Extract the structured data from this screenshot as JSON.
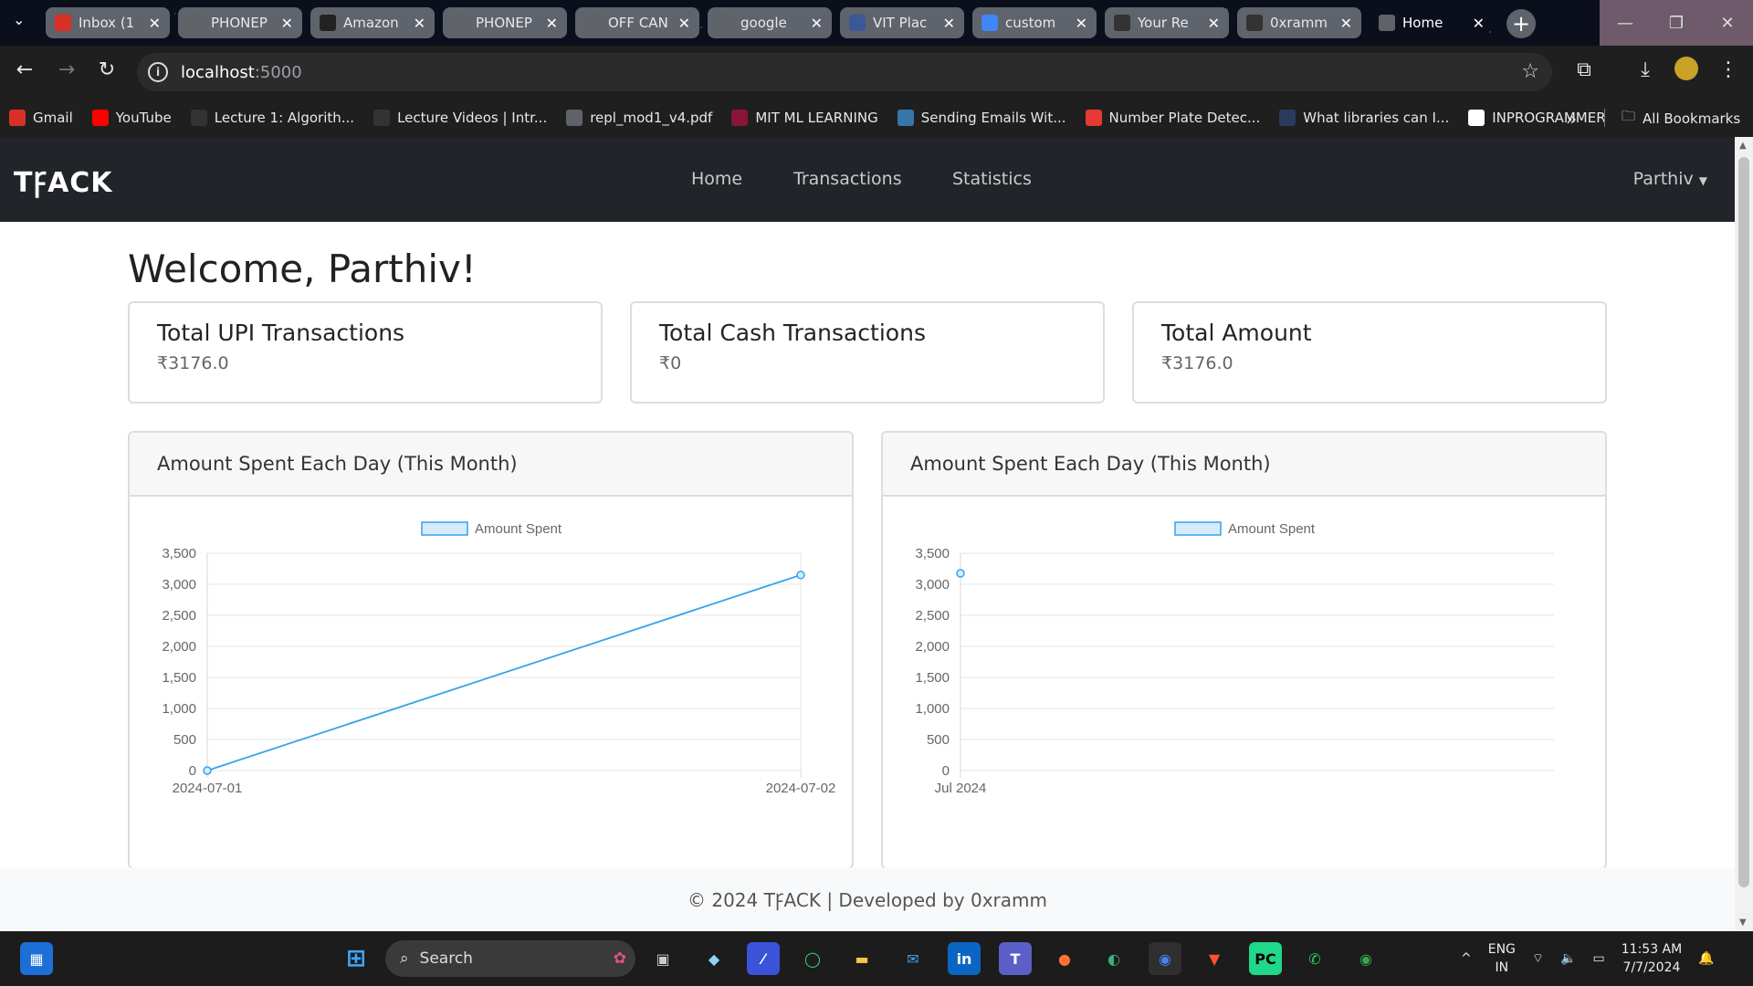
{
  "browser": {
    "tabs": [
      {
        "title": "Inbox (1",
        "icon": "gmail-icon",
        "color": "#d93025"
      },
      {
        "title": "PHONEP",
        "icon": "web-icon",
        "color": "#5f6368"
      },
      {
        "title": "Amazon",
        "icon": "amazon-icon",
        "color": "#222222"
      },
      {
        "title": "PHONEP",
        "icon": "web-icon",
        "color": "#5f6368"
      },
      {
        "title": "OFF CAN",
        "icon": "web-icon",
        "color": "#5f6368"
      },
      {
        "title": "google",
        "icon": "web-icon",
        "color": "#5f6368"
      },
      {
        "title": "VIT Plac",
        "icon": "vit-icon",
        "color": "#3b5998"
      },
      {
        "title": "custom",
        "icon": "google-icon",
        "color": "#4285f4"
      },
      {
        "title": "Your Re",
        "icon": "github-icon",
        "color": "#333333"
      },
      {
        "title": "0xramm",
        "icon": "github-icon",
        "color": "#333333"
      },
      {
        "title": "Home",
        "icon": "globe-icon",
        "color": "#5f6368"
      }
    ],
    "url": {
      "host": "localhost",
      "port": ":5000"
    },
    "bookmarks": [
      {
        "label": "Gmail",
        "icon": "gmail-icon",
        "color": "#d93025"
      },
      {
        "label": "YouTube",
        "icon": "youtube-icon",
        "color": "#ff0000"
      },
      {
        "label": "Lecture 1: Algorith...",
        "icon": "mit-icon",
        "color": "#333333"
      },
      {
        "label": "Lecture Videos | Intr...",
        "icon": "mit-icon",
        "color": "#333333"
      },
      {
        "label": "repl_mod1_v4.pdf",
        "icon": "globe-icon",
        "color": "#5f6368"
      },
      {
        "label": "MIT ML LEARNING",
        "icon": "mit-icon",
        "color": "#8a1538"
      },
      {
        "label": "Sending Emails Wit...",
        "icon": "python-icon",
        "color": "#3776ab"
      },
      {
        "label": "Number Plate Detec...",
        "icon": "red-icon",
        "color": "#e53935"
      },
      {
        "label": "What libraries can I...",
        "icon": "tds-icon",
        "color": "#2a3b5c"
      },
      {
        "label": "INPROGRAMMER",
        "icon": "doc-icon",
        "color": "#ffffff"
      }
    ],
    "all_bookmarks": "All Bookmarks"
  },
  "app": {
    "brand": "TꝻACK",
    "nav": {
      "home": "Home",
      "transactions": "Transactions",
      "statistics": "Statistics",
      "user": "Parthiv"
    },
    "welcome": "Welcome, Parthiv!",
    "cards": [
      {
        "title": "Total UPI Transactions",
        "value": "₹3176.0"
      },
      {
        "title": "Total Cash Transactions",
        "value": "₹0"
      },
      {
        "title": "Total Amount",
        "value": "₹3176.0"
      }
    ],
    "footer": "© 2024 TꝻACK | Developed by 0xramm"
  },
  "chart_data": [
    {
      "type": "line",
      "title": "Amount Spent Each Day (This Month)",
      "legend": "Amount Spent",
      "x": [
        "2024-07-01",
        "2024-07-02"
      ],
      "series": [
        {
          "name": "Amount Spent",
          "values": [
            0,
            3150
          ]
        }
      ],
      "ylim": [
        0,
        3500
      ],
      "yticks": [
        "3,500",
        "3,000",
        "2,500",
        "2,000",
        "1,500",
        "1,000",
        "500",
        "0"
      ],
      "color": "#36a2eb"
    },
    {
      "type": "line",
      "title": "Amount Spent Each Day (This Month)",
      "legend": "Amount Spent",
      "x": [
        "Jul 2024"
      ],
      "series": [
        {
          "name": "Amount Spent",
          "values": [
            3176
          ]
        }
      ],
      "ylim": [
        0,
        3500
      ],
      "yticks": [
        "3,500",
        "3,000",
        "2,500",
        "2,000",
        "1,500",
        "1,000",
        "500",
        "0"
      ],
      "color": "#36a2eb"
    }
  ],
  "taskbar": {
    "search": "Search",
    "lang": [
      "ENG",
      "IN"
    ],
    "time": "11:53 AM",
    "date": "7/7/2024"
  }
}
